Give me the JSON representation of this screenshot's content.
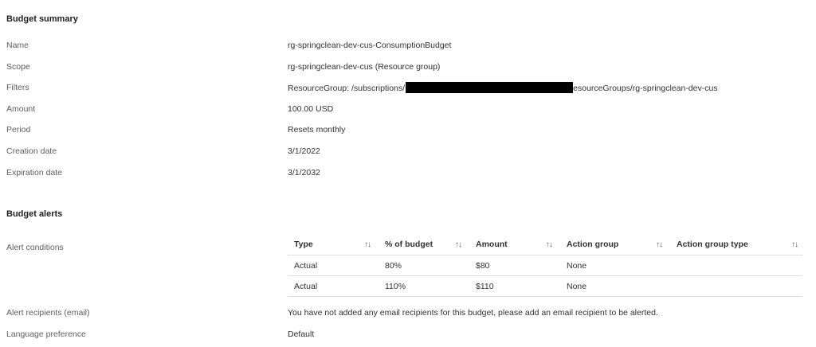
{
  "summary": {
    "title": "Budget summary",
    "rows": [
      {
        "label": "Name",
        "value": "rg-springclean-dev-cus-ConsumptionBudget"
      },
      {
        "label": "Scope",
        "value": "rg-springclean-dev-cus (Resource group)"
      },
      {
        "label": "Filters",
        "value_prefix": "ResourceGroup: /subscriptions/",
        "value_suffix": "esourceGroups/rg-springclean-dev-cus"
      },
      {
        "label": "Amount",
        "value": "100.00 USD"
      },
      {
        "label": "Period",
        "value": "Resets monthly"
      },
      {
        "label": "Creation date",
        "value": "3/1/2022"
      },
      {
        "label": "Expiration date",
        "value": "3/1/2032"
      }
    ]
  },
  "alerts": {
    "title": "Budget alerts",
    "conditions_label": "Alert conditions",
    "columns": [
      "Type",
      "% of budget",
      "Amount",
      "Action group",
      "Action group type"
    ],
    "sort_icon": "↑↓",
    "rows": [
      [
        "Actual",
        "80%",
        "$80",
        "None",
        ""
      ],
      [
        "Actual",
        "110%",
        "$110",
        "None",
        ""
      ]
    ],
    "recipients_label": "Alert recipients (email)",
    "recipients_value": "You have not added any email recipients for this budget, please add an email recipient to be alerted.",
    "language_label": "Language preference",
    "language_value": "Default"
  }
}
